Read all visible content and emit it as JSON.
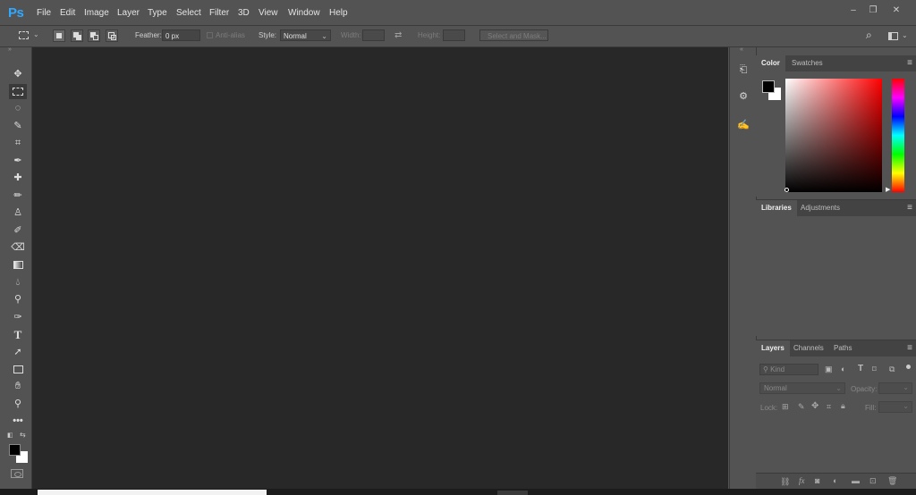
{
  "app": {
    "logo": "Ps"
  },
  "menu": [
    "File",
    "Edit",
    "Image",
    "Layer",
    "Type",
    "Select",
    "Filter",
    "3D",
    "View",
    "Window",
    "Help"
  ],
  "window_controls": {
    "minimize": "–",
    "restore": "❐",
    "close": "✕"
  },
  "options": {
    "feather_label": "Feather:",
    "feather_value": "0 px",
    "antialias_label": "Anti-alias",
    "style_label": "Style:",
    "style_value": "Normal",
    "width_label": "Width:",
    "height_label": "Height:",
    "select_mask_label": "Select and Mask..."
  },
  "color_panel": {
    "tabs": [
      "Color",
      "Swatches"
    ],
    "foreground": "#000000",
    "background": "#ffffff",
    "hue": "#ff0000"
  },
  "libraries_panel": {
    "tabs": [
      "Libraries",
      "Adjustments"
    ]
  },
  "layers_panel": {
    "tabs": [
      "Layers",
      "Channels",
      "Paths"
    ],
    "kind_placeholder": "Kind",
    "blend_mode": "Normal",
    "opacity_label": "Opacity:",
    "lock_label": "Lock:",
    "fill_label": "Fill:"
  },
  "colors": {
    "accent": "#31a8ff",
    "canvas": "#282828",
    "panel": "#535353"
  }
}
